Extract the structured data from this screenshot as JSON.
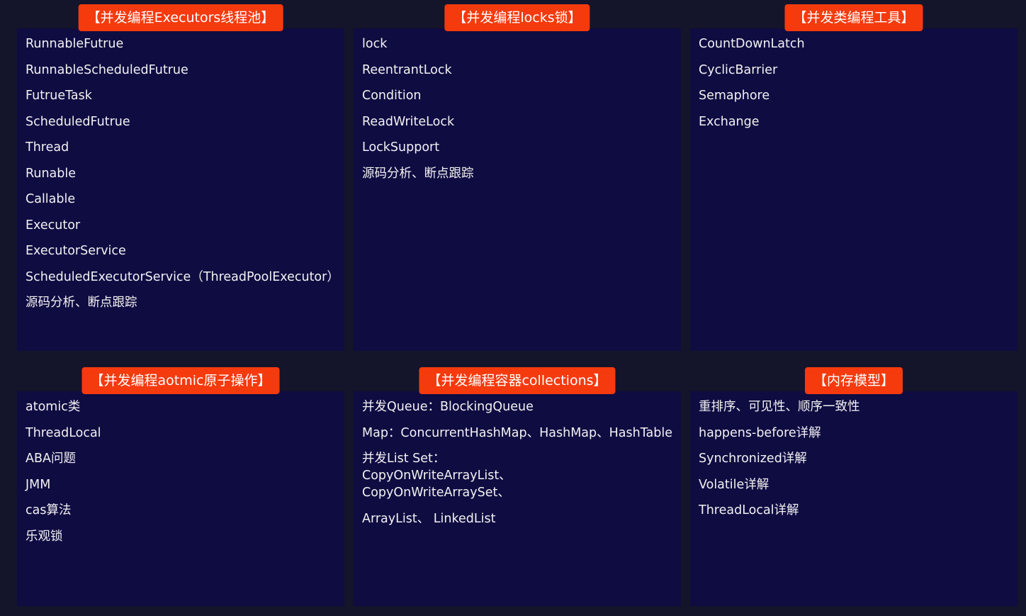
{
  "colors": {
    "background": "#14142a",
    "card_background": "#0f0c42",
    "title_badge": "#f53a0e",
    "text": "#f2f2f2"
  },
  "cards": [
    {
      "title": "【并发编程Executors线程池】",
      "items": [
        "RunnableFutrue",
        "RunnableScheduledFutrue",
        "FutrueTask",
        "ScheduledFutrue",
        "Thread",
        "Runable",
        "Callable",
        "Executor",
        "ExecutorService",
        "ScheduledExecutorService（ThreadPoolExecutor）",
        "源码分析、断点跟踪"
      ]
    },
    {
      "title": "【并发编程locks锁】",
      "items": [
        "lock",
        "ReentrantLock",
        "Condition",
        "ReadWriteLock",
        "LockSupport",
        "源码分析、断点跟踪"
      ]
    },
    {
      "title": "【并发类编程工具】",
      "items": [
        "CountDownLatch",
        "CyclicBarrier",
        "Semaphore",
        "Exchange"
      ]
    },
    {
      "title": "【并发编程aotmic原子操作】",
      "items": [
        "atomic类",
        "ThreadLocal",
        "ABA问题",
        "JMM",
        "cas算法",
        "乐观锁"
      ]
    },
    {
      "title": "【并发编程容器collections】",
      "items": [
        "并发Queue：BlockingQueue",
        "Map：ConcurrentHashMap、HashMap、HashTable",
        "并发List Set：CopyOnWriteArrayList、CopyOnWriteArraySet、",
        "ArrayList、 LinkedList"
      ]
    },
    {
      "title": "【内存模型】",
      "items": [
        "重排序、可见性、顺序一致性",
        "happens-before详解",
        "Synchronized详解",
        "Volatile详解",
        "ThreadLocal详解"
      ]
    }
  ]
}
